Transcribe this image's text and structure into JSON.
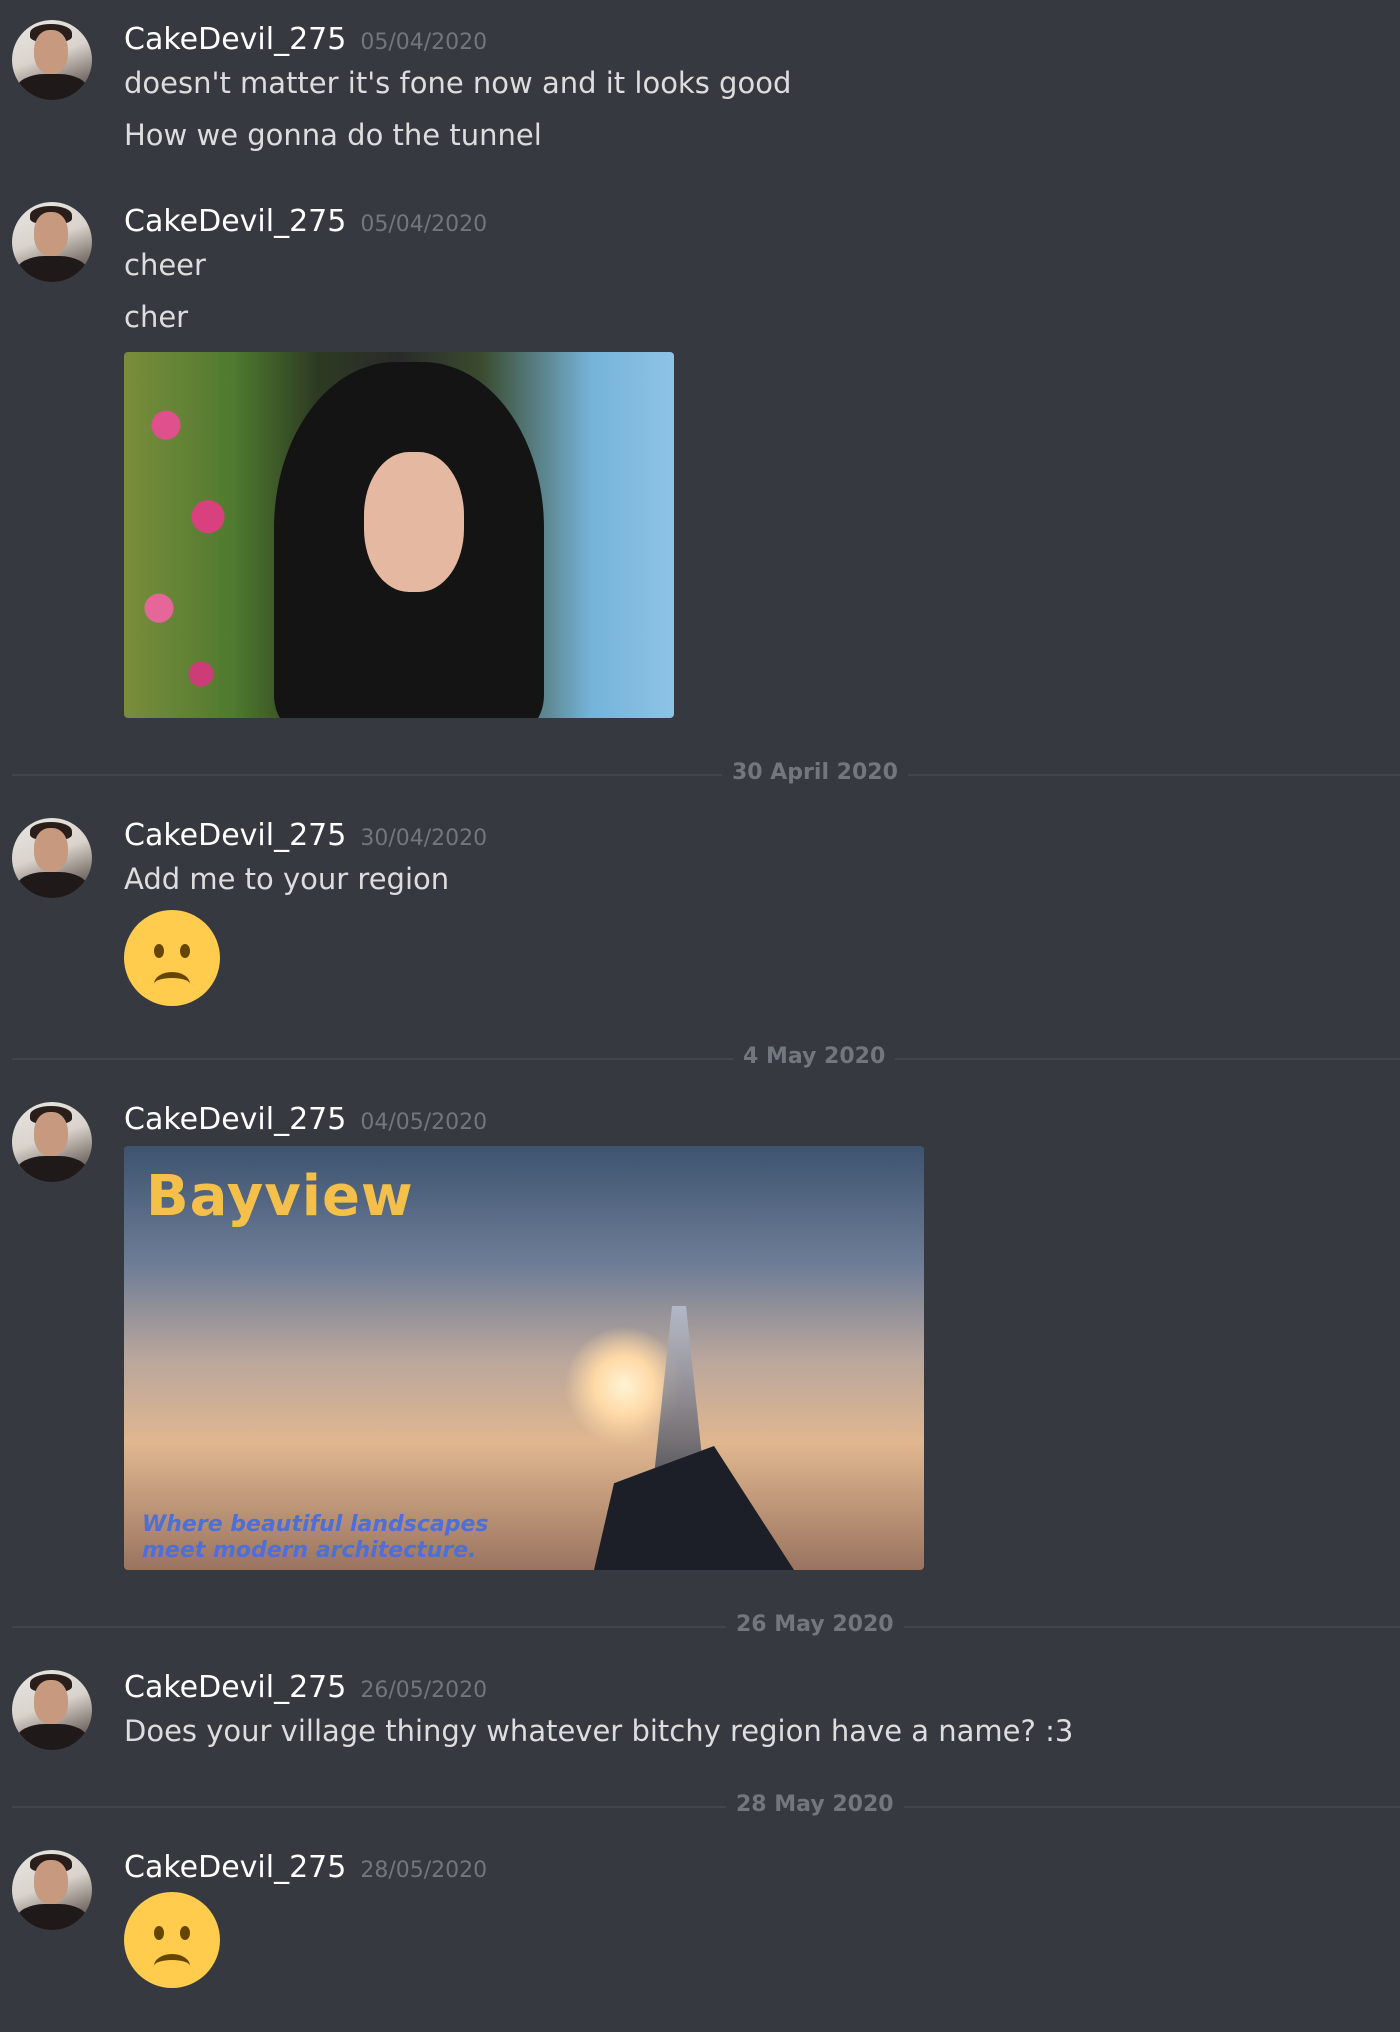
{
  "messages": [
    {
      "username": "CakeDevil_275",
      "timestamp": "05/04/2020",
      "lines": [
        "doesn't matter it's fone now and it looks good",
        "How we gonna do the tunnel"
      ]
    },
    {
      "username": "CakeDevil_275",
      "timestamp": "05/04/2020",
      "lines": [
        "cheer",
        "cher"
      ],
      "attachment": "photo-cher"
    },
    {
      "username": "CakeDevil_275",
      "timestamp": "30/04/2020",
      "lines": [
        "Add me to your region"
      ],
      "emoji": "frowning-face"
    },
    {
      "username": "CakeDevil_275",
      "timestamp": "04/05/2020",
      "attachment": "bayview-banner",
      "banner": {
        "title": "Bayview",
        "tagline": "Where beautiful landscapes\nmeet modern architecture."
      }
    },
    {
      "username": "CakeDevil_275",
      "timestamp": "26/05/2020",
      "lines": [
        "Does your village thingy whatever bitchy region have a name? :3"
      ]
    },
    {
      "username": "CakeDevil_275",
      "timestamp": "28/05/2020",
      "emoji": "frowning-face"
    }
  ],
  "dividers": [
    "30 April 2020",
    "4 May 2020",
    "26 May 2020",
    "28 May 2020"
  ],
  "colors": {
    "background": "#36393f",
    "username": "#ffffff",
    "timestamp": "#72767d",
    "text": "#dcddde",
    "emoji": "#ffcc4d",
    "banner_title": "#f5c04a",
    "banner_tagline": "#4f6fd6"
  }
}
